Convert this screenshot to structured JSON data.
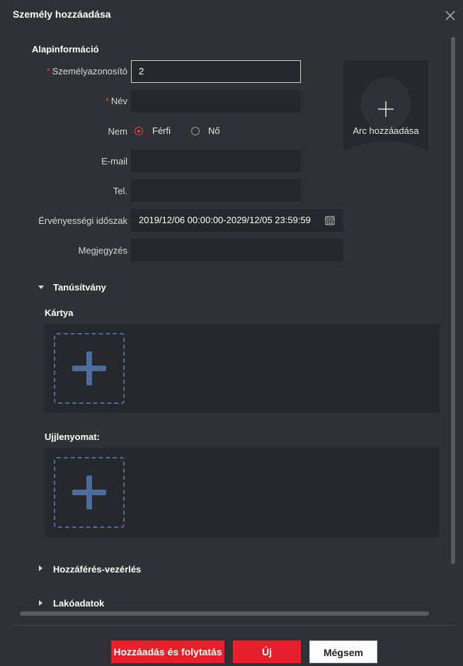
{
  "dialog": {
    "title": "Személy hozzáadása",
    "close_icon": "close-icon"
  },
  "basic": {
    "section_title": "Alapinformáció",
    "person_id": {
      "label": "Személyazonosító",
      "value": "2",
      "required": "*"
    },
    "name": {
      "label": "Név",
      "value": "",
      "required": "*"
    },
    "gender": {
      "label": "Nem",
      "options": [
        "Férfi",
        "Nő"
      ],
      "selected": "Férfi"
    },
    "email": {
      "label": "E-mail",
      "value": ""
    },
    "phone": {
      "label": "Tel.",
      "value": ""
    },
    "validity": {
      "label": "Érvényességi időszak",
      "value": "2019/12/06 00:00:00-2029/12/05 23:59:59"
    },
    "remark": {
      "label": "Megjegyzés",
      "value": ""
    },
    "face": {
      "label": "Arc hozzáadása"
    }
  },
  "credential": {
    "section_title": "Tanúsítvány",
    "card_title": "Kártya",
    "fingerprint_title": "Ujjlenyomat:"
  },
  "collapsed": {
    "access_control": "Hozzáférés-vezérlés",
    "resident": "Lakóadatok"
  },
  "footer": {
    "add_continue": "Hozzáadás és folytatás",
    "new": "Új",
    "cancel": "Mégsem"
  },
  "colors": {
    "accent": "#e6212b",
    "dashed": "#4d6c9c",
    "background": "#303134"
  }
}
